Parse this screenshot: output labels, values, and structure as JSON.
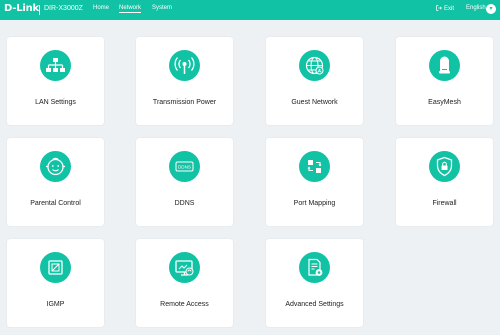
{
  "header": {
    "brand": "D-Link",
    "model": "DIR-X3000Z",
    "nav": {
      "home": "Home",
      "network": "Network",
      "system": "System"
    },
    "exit": "Exit",
    "language": "English"
  },
  "colors": {
    "accent": "#12c2a4",
    "background": "#eef1f4",
    "card": "#ffffff"
  },
  "cards": [
    {
      "label": "LAN Settings",
      "icon": "lan-icon"
    },
    {
      "label": "Transmission Power",
      "icon": "wifi-signal-icon"
    },
    {
      "label": "Guest Network",
      "icon": "guest-globe-icon"
    },
    {
      "label": "EasyMesh",
      "icon": "mesh-router-icon"
    },
    {
      "label": "Parental Control",
      "icon": "child-face-icon"
    },
    {
      "label": "DDNS",
      "icon": "ddns-icon"
    },
    {
      "label": "Port Mapping",
      "icon": "port-mapping-icon"
    },
    {
      "label": "Firewall",
      "icon": "shield-lock-icon"
    },
    {
      "label": "IGMP",
      "icon": "igmp-icon"
    },
    {
      "label": "Remote Access",
      "icon": "remote-access-icon"
    },
    {
      "label": "Advanced Settings",
      "icon": "advanced-settings-icon"
    }
  ]
}
